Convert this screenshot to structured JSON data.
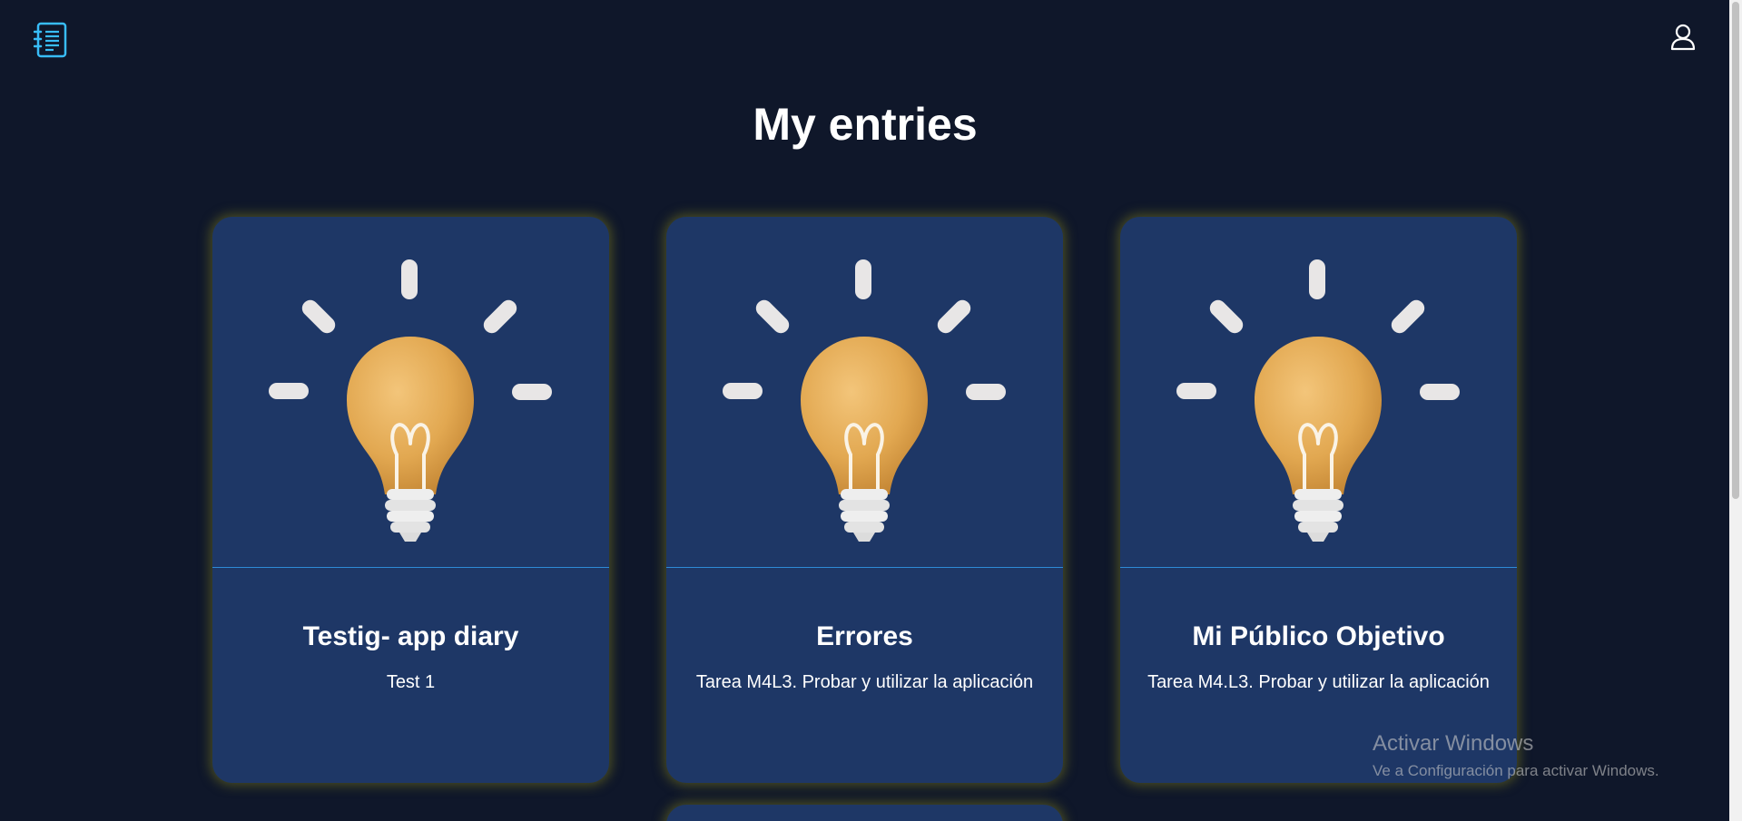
{
  "header": {
    "logo_icon": "notebook-icon",
    "user_icon": "user-icon"
  },
  "page_title": "My entries",
  "entries": [
    {
      "title": "Testig- app diary",
      "description": "Test 1",
      "image": "lightbulb-icon"
    },
    {
      "title": "Errores",
      "description": "Tarea M4L3. Probar y utilizar la aplicación",
      "image": "lightbulb-icon"
    },
    {
      "title": "Mi Público Objetivo",
      "description": "Tarea M4.L3. Probar y utilizar la aplicación",
      "image": "lightbulb-icon"
    }
  ],
  "watermark": {
    "title": "Activar Windows",
    "subtitle": "Ve a Configuración para activar Windows."
  },
  "colors": {
    "background": "#0f172a",
    "card": "#1e3766",
    "accent": "#38bdf8",
    "divider": "#2e8ad6",
    "bulb": "#e9b35b"
  }
}
